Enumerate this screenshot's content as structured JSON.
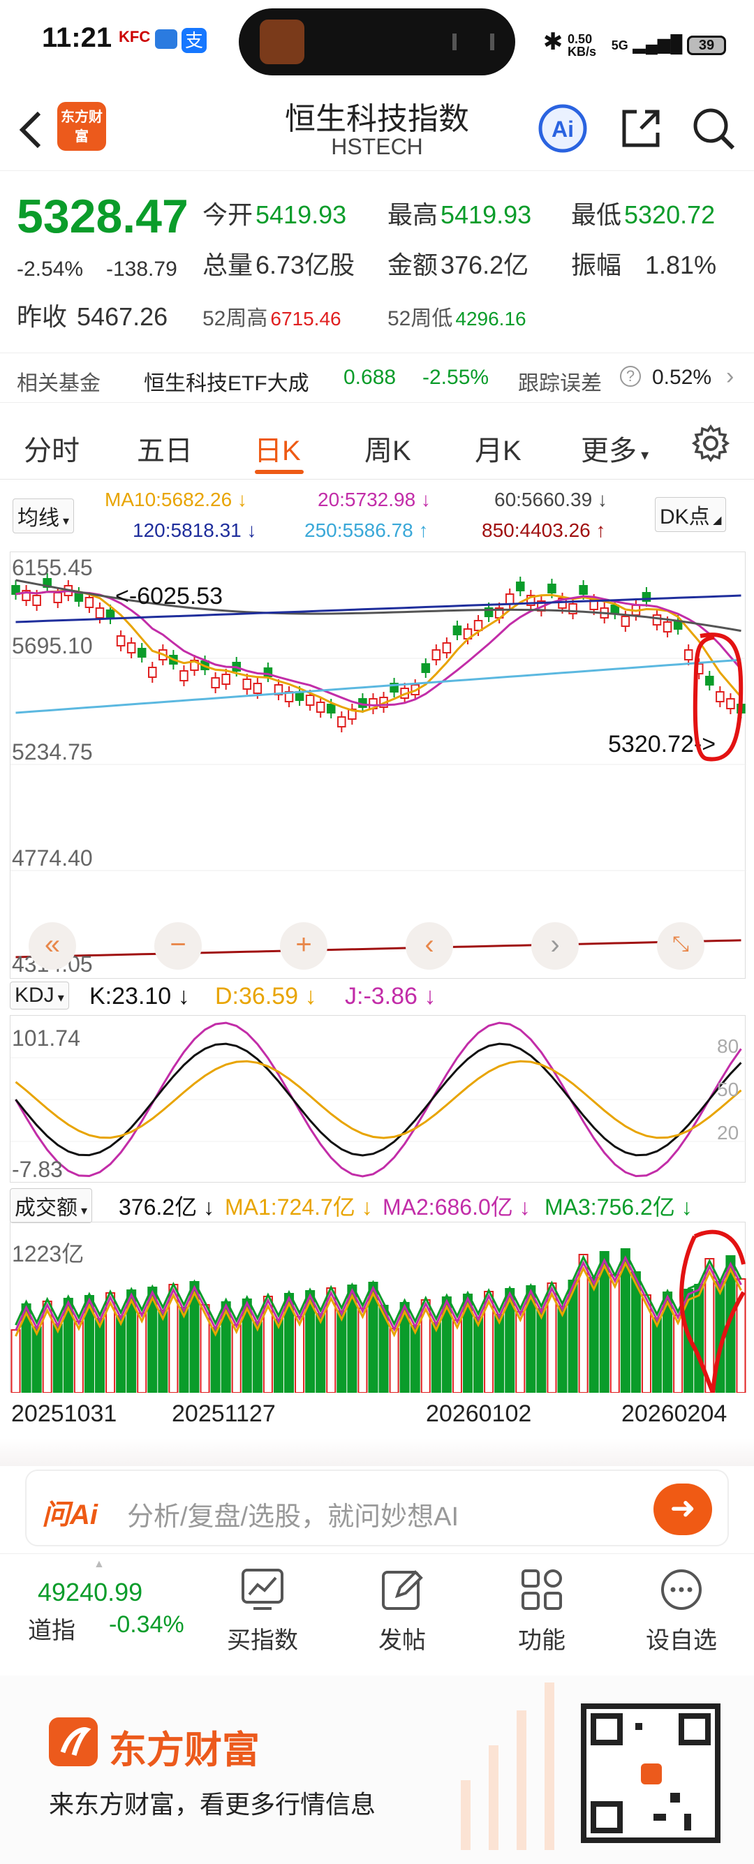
{
  "status": {
    "time": "11:21",
    "net_speed": "0.50 KB/s",
    "network": "5G",
    "battery": "39"
  },
  "header": {
    "back_icon": "chevron-left-icon",
    "logo_text": "东方财富",
    "title": "恒生科技指数",
    "subtitle": "HSTECH",
    "ai_label": "Ai"
  },
  "quote": {
    "price": "5328.47",
    "change_pct": "-2.54%",
    "change_abs": "-138.79",
    "open_label": "今开",
    "open": "5419.93",
    "high_label": "最高",
    "high": "5419.93",
    "low_label": "最低",
    "low": "5320.72",
    "vol_label": "总量",
    "vol": "6.73亿股",
    "amt_label": "金额",
    "amt": "376.2亿",
    "amp_label": "振幅",
    "amp": "1.81%",
    "prev_label": "昨收",
    "prev": "5467.26",
    "wk52_high_label": "52周高",
    "wk52_high": "6715.46",
    "wk52_low_label": "52周低",
    "wk52_low": "4296.16"
  },
  "fund": {
    "label": "相关基金",
    "name": "恒生科技ETF大成",
    "price": "0.688",
    "pct": "-2.55%",
    "err_label": "跟踪误差",
    "err": "0.52%"
  },
  "tabs": [
    "分时",
    "五日",
    "日K",
    "周K",
    "月K",
    "更多"
  ],
  "active_tab": 2,
  "ma_legend": {
    "selector": "均线",
    "ma10": "MA10:5682.26 ↓",
    "ma20": "20:5732.98 ↓",
    "ma60": "60:5660.39 ↓",
    "ma120": "120:5818.31 ↓",
    "ma250": "250:5586.78 ↑",
    "ma850": "850:4403.26 ↑",
    "dk": "DK点"
  },
  "kline": {
    "y_labels": [
      "6155.45",
      "5695.10",
      "5234.75",
      "4774.40",
      "4314.05"
    ],
    "max_marker": "<-6025.53",
    "min_marker": "5320.72->"
  },
  "kdj": {
    "selector": "KDJ",
    "k": "K:23.10 ↓",
    "d": "D:36.59 ↓",
    "j": "J:-3.86 ↓",
    "y_top": "101.74",
    "y_bottom": "-7.83",
    "right_labels": [
      "80",
      "50",
      "20"
    ]
  },
  "volume": {
    "selector": "成交额",
    "cur": "376.2亿 ↓",
    "ma1": "MA1:724.7亿 ↓",
    "ma2": "MA2:686.0亿 ↓",
    "ma3": "MA3:756.2亿 ↓",
    "y_top": "1223亿",
    "dates": [
      "20251031",
      "20251127",
      "20260102",
      "20260204"
    ]
  },
  "ask_ai": {
    "brand": "问Ai",
    "placeholder": "分析/复盘/选股，就问妙想AI"
  },
  "bottom_nav": {
    "ticker_value": "49240.99",
    "ticker_name": "道指",
    "ticker_pct": "-0.34%",
    "items": [
      "买指数",
      "发帖",
      "功能",
      "设自选"
    ]
  },
  "footer": {
    "brand": "东方财富",
    "slogan": "来东方财富，看更多行情信息"
  },
  "colors": {
    "up": "#e02020",
    "down": "#0a9c2a",
    "accent": "#ee5a14",
    "ma10": "#e8a400",
    "ma20": "#c22da8",
    "ma60": "#555555",
    "ma120": "#1f2e9c",
    "ma250": "#5bb8e0",
    "ma850": "#a01010"
  }
}
